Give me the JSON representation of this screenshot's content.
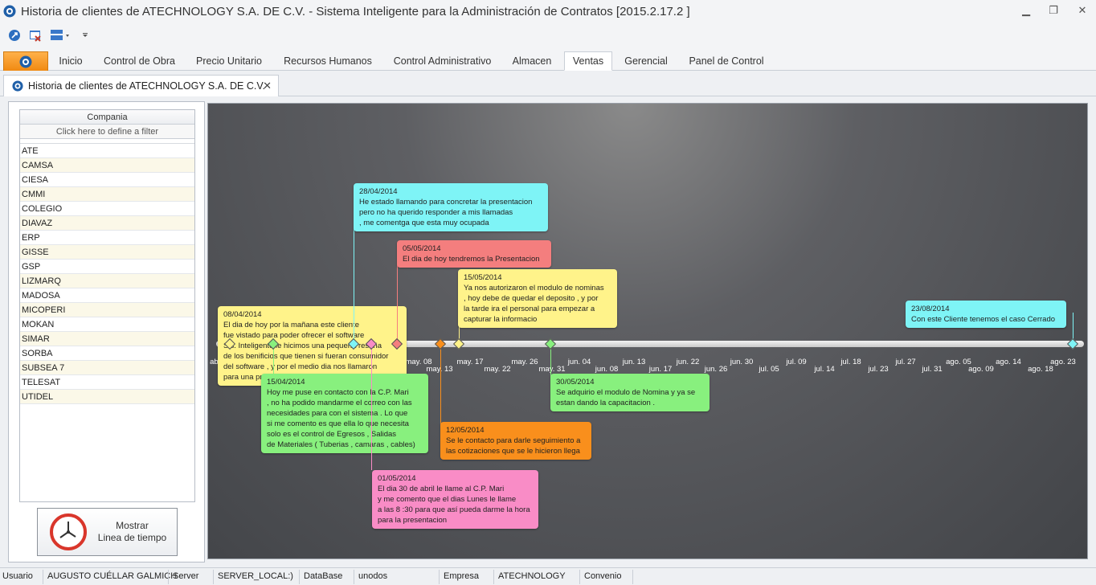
{
  "window": {
    "title": "Historia de clientes de ATECHNOLOGY S.A. DE C.V. - Sistema Inteligente para la Administración de Contratos  [2015.2.17.2 ]",
    "minimize": "▁",
    "restore": "❐",
    "close": "✕"
  },
  "ribbon": {
    "tabs": [
      {
        "label": "Inicio"
      },
      {
        "label": "Control de Obra"
      },
      {
        "label": "Precio Unitario"
      },
      {
        "label": "Recursos Humanos"
      },
      {
        "label": "Control Administrativo"
      },
      {
        "label": "Almacen"
      },
      {
        "label": "Ventas"
      },
      {
        "label": "Gerencial"
      },
      {
        "label": "Panel de Control"
      }
    ],
    "active_tab": "Ventas"
  },
  "document_tab": {
    "label": "Historia de clientes de ATECHNOLOGY S.A. DE C.V.",
    "close": "✕"
  },
  "company_grid": {
    "header": "Compania",
    "filter_placeholder": "Click here to define a filter",
    "rows": [
      "ATE",
      "CAMSA",
      "CIESA",
      "CMMI",
      "COLEGIO",
      "DIAVAZ",
      "ERP",
      "GISSE",
      "GSP",
      "LIZMARQ",
      "MADOSA",
      "MICOPERI",
      "MOKAN",
      "SIMAR",
      "SORBA",
      "SUBSEA 7",
      "TELESAT",
      "UTIDEL"
    ]
  },
  "show_timeline_button": {
    "label": "Mostrar\nLinea de tiempo"
  },
  "timeline": {
    "ticks": [
      "abr.",
      "may. 08",
      "may. 13",
      "may. 17",
      "may. 22",
      "may. 26",
      "may. 31",
      "jun. 04",
      "jun. 08",
      "jun. 13",
      "jun. 17",
      "jun. 22",
      "jun. 26",
      "jun. 30",
      "jul. 05",
      "jul. 09",
      "jul. 14",
      "jul. 18",
      "jul. 23",
      "jul. 27",
      "jul. 31",
      "ago. 05",
      "ago. 09",
      "ago. 14",
      "ago. 18",
      "ago. 23"
    ],
    "events": [
      {
        "date": "08/04/2014",
        "text": "El dia de hoy por la mañana este cliente\nfue vistado para poder ofrecer el software\nSis. Inteligente le hicimos una pequeña reseña\nde los benificios que tienen si fueran consumidor\ndel software , y por el medio dia nos llamaron\npara una presentacion",
        "color": "#fff38a"
      },
      {
        "date": "15/04/2014",
        "text": "Hoy me puse en contacto con la C.P. Mari\n, no ha podido mandarme el correo  con las\nnecesidades para con el sistema . Lo que\nsi me comento es que ella lo que necesita\nsolo es el control de Egresos , Salidas\nde Materiales ( Tuberias , camaras , cables)",
        "color": "#88f07e"
      },
      {
        "date": "28/04/2014",
        "text": "He estado llamando para concretar la presentacion\npero no ha querido responder a mis llamadas\n, me comentga que esta muy ocupada",
        "color": "#7ef4f6"
      },
      {
        "date": "01/05/2014",
        "text": "El dia 30 de abril le llame al  C.P. Mari\ny me comento que el dias Lunes le llame\na las 8 :30 para que así pueda darme la hora\npara la presentacion",
        "color": "#f98cc6"
      },
      {
        "date": "05/05/2014",
        "text": "El dia de hoy tendremos la Presentacion",
        "color": "#f47e7e"
      },
      {
        "date": "12/05/2014",
        "text": "Se le contacto para darle seguimiento a\nlas cotizaciones que se le hicieron llega",
        "color": "#f98f1c"
      },
      {
        "date": "15/05/2014",
        "text": "Ya nos autorizaron el modulo de nominas\n, hoy debe de quedar el deposito , y por\nla tarde ira el personal para empezar a\ncapturar la informacio",
        "color": "#fff38a"
      },
      {
        "date": "30/05/2014",
        "text": "Se adquirio el modulo de Nomina  y ya se\nestan dando la capacitacion .",
        "color": "#88f07e"
      },
      {
        "date": "23/08/2014",
        "text": "Con este Cliente tenemos el caso Cerrado",
        "color": "#7ef4f6"
      }
    ]
  },
  "status": {
    "usuario_label": "Usuario",
    "usuario_value": "AUGUSTO CUÉLLAR GALMICH",
    "server_label": "Server",
    "server_value": "SERVER_LOCAL:)",
    "database_label": "DataBase",
    "database_value": "unodos",
    "empresa_label": "Empresa",
    "empresa_value": "ATECHNOLOGY",
    "convenio_label": "Convenio"
  }
}
